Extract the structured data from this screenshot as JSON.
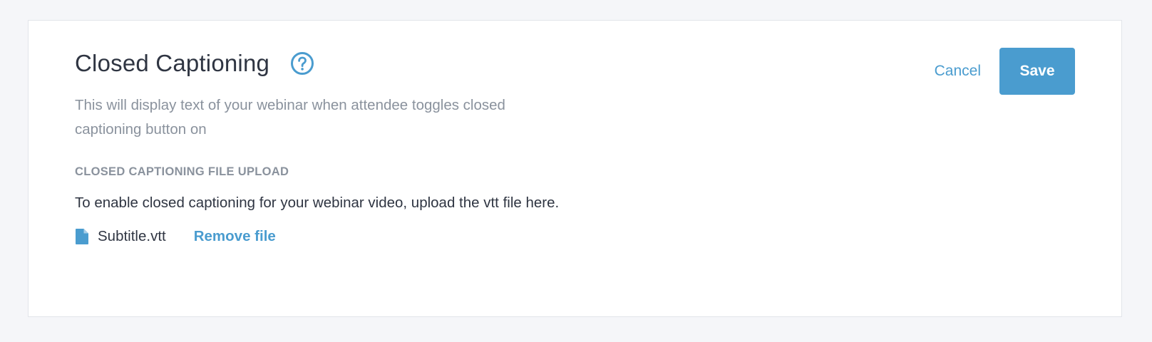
{
  "header": {
    "title": "Closed Captioning",
    "help_icon": "question-circle-icon",
    "description": "This will display text of your webinar when attendee toggles closed captioning button on"
  },
  "upload": {
    "section_label": "CLOSED CAPTIONING FILE UPLOAD",
    "instruction": "To enable closed captioning for your webinar video, upload the vtt file here.",
    "file_icon": "file-icon",
    "file_name": "Subtitle.vtt",
    "remove_label": "Remove file"
  },
  "actions": {
    "cancel_label": "Cancel",
    "save_label": "Save"
  },
  "colors": {
    "accent": "#4a9ccf",
    "text_primary": "#2f3542",
    "text_muted": "#8a929d",
    "background": "#f5f6f9",
    "card": "#ffffff"
  }
}
